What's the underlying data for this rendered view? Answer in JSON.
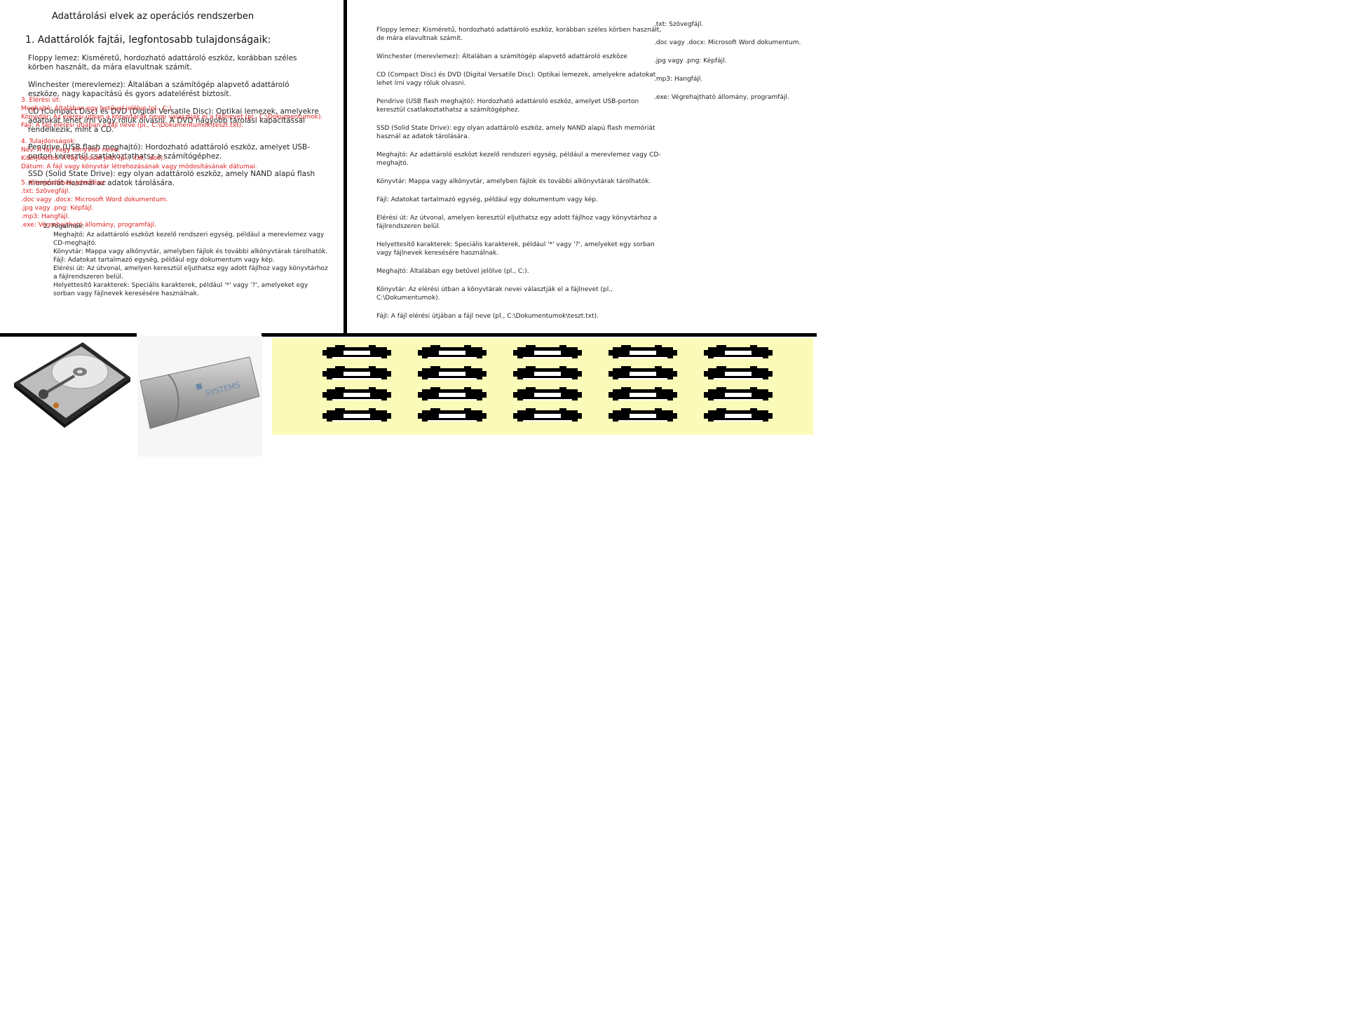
{
  "title": "Adattárolási elvek az operációs rendszerben",
  "heading1": "1. Adattárolók fajtái, legfontosabb tulajdonságaik:",
  "left_overlay_black": [
    "Floppy lemez: Kisméretű, hordozható adattároló eszköz, korábban széles körben használt, da mára elavultnak számít.",
    "Winchester (merevlemez): Általában a számítógép alapvető adattároló eszköze, nagy kapacitású és gyors adatelérést biztosít.",
    "CD (Compact Disc) és DVD (Digital Versatile Disc): Optikai lemezek, amelyekre adatokat lehet írni vagy róluk olvasni. A DVD nagyobb tárolási kapacitással rendelkezik, mint a CD.",
    "Pendrive (USB flash meghajtó): Hordozható adattároló eszköz, amelyet USB-porton keresztül csatlakoztathatsz a számítógéphez.",
    "SSD (Solid State Drive): egy olyan adattároló eszköz, amely NAND alapú flash memóriát használ az adatok tárolására."
  ],
  "left_overlay_red": [
    "3. Elérési út:",
    "Meghajtó: Általában egy betűvel jelölve (pl., C:).",
    "Könyvtár: Az elérési útban a könyvtárak nevei választják el a fájlnevet (pl., C:\\Dokumentumok).",
    "Fájl: A fájl elérési útjában a fájl neve (pl., C:\\Dokumentumok\\teszt.txt).",
    "",
    "4. Tulajdonságok:",
    "Név: A fájl vagy könyvtár neve.",
    "Kiterjesztés: A fájl típusát jelzi (pl., .txt, .doc).",
    "Dátum: A fájl vagy könyvtár létrehozásának vagy módosításának dátumai.",
    "",
    "5. Kiterjesztések jelentése:",
    ".txt: Szövegfájl.",
    ".doc vagy .docx: Microsoft Word dokumentum.",
    ".jpg vagy .png: Képfájl.",
    ".mp3: Hangfájl.",
    ".exe: Végrehajtható állomány, programfájl."
  ],
  "left_fogalmak": {
    "heading": "2. Fogalmak:",
    "items": [
      "Meghajtó: Az adattároló eszközt kezelő rendszeri egység, például a merevlemez vagy CD-meghajtó.",
      "Könyvtár: Mappa vagy alkönyvtár, amelyben fájlok és további alkönyvtárak tárolhatók.",
      "Fájl: Adatokat tartalmazó egység, például egy dokumentum vagy kép.",
      "Elérési út: Az útvonal, amelyen keresztül eljuthatsz egy adott fájlhoz vagy könyvtárhoz a fájlrendszeren belül.",
      "Helyettesítő karakterek: Speciális karakterek, például '*' vagy '?', amelyeket egy sorban vagy fájlnevek keresésére használnak."
    ]
  },
  "col2": [
    "Floppy lemez: Kisméretű, hordozható adattároló eszköz, korábban széles körben használt, de mára elavultnak számít.",
    "Winchester (merevlemez): Általában a számítógép alapvető adattároló eszköze",
    "CD (Compact Disc) és DVD (Digital Versatile Disc): Optikai lemezek, amelyekre adatokat lehet írni vagy róluk olvasni.",
    "Pendrive (USB flash meghajtó): Hordozható adattároló eszköz, amelyet USB-porton keresztül csatlakoztathatsz a számítógéphez.",
    "SSD (Solid State Drive): egy olyan adattároló eszköz, amely NAND alapú flash memóriát használ az adatok tárolására.",
    "Meghajtó: Az adattároló eszközt kezelő rendszeri egység, például a merevlemez vagy CD-meghajtó.",
    "Könyvtár: Mappa vagy alkönyvtár, amelyben fájlok és további alkönyvtárak tárolhatók.",
    "Fájl: Adatokat tartalmazó egység, például egy dokumentum vagy kép.",
    "Elérési út: Az útvonal, amelyen keresztül eljuthatsz egy adott fájlhoz vagy könyvtárhoz a fájlrendszeren belül.",
    "Helyettesítő karakterek: Speciális karakterek, például '*' vagy '?', amelyeket egy sorban vagy fájlnevek keresésére használnak.",
    "Meghajtó: Általában egy betűvel jelölve (pl., C:).",
    "Könyvtár: Az elérési útban a könyvtárak nevei választják el a fájlnevet (pl., C:\\Dokumentumok).",
    "Fájl: A fájl elérési útjában a fájl neve (pl., C:\\Dokumentumok\\teszt.txt)."
  ],
  "col3": [
    ".txt: Szövegfájl.",
    ".doc vagy .docx: Microsoft Word dokumentum.",
    ".jpg vagy .png: Képfájl.",
    ".mp3: Hangfájl.",
    ".exe: Végrehajtható állomány, programfájl."
  ],
  "usb_brand": "SYSTEMS",
  "colors": {
    "divider": "#000000",
    "red_text": "#e02020",
    "icon_panel": "#fbfbb9"
  },
  "file_icons": [
    "pdf-icon",
    "doc-icon",
    "xls-icon",
    "jpg-icon",
    "mp3-icon",
    "txt-icon",
    "png-icon",
    "html-icon",
    "ppt-icon",
    "zip-icon",
    "exe-icon",
    "avi-icon",
    "docx-icon",
    "gif-icon",
    "rar-icon",
    "psd-icon",
    "csv-icon",
    "js-icon",
    "mov-icon",
    "svg-icon"
  ]
}
